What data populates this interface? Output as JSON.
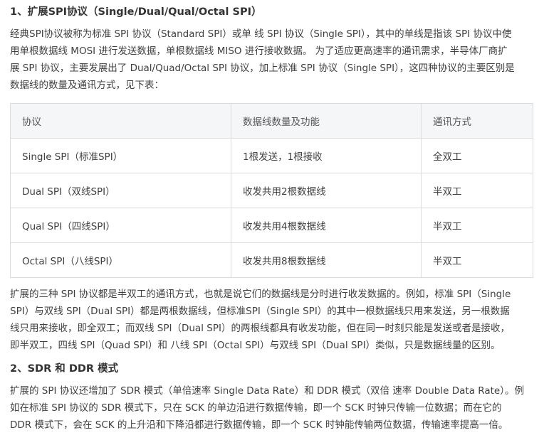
{
  "section1": {
    "heading": "1、扩展SPI协议（Single/Dual/Qual/Octal SPI）",
    "intro_lines": [
      "经典SPI协议被称为标准 SPI 协议（Standard SPI）或单 线 SPI 协议（Single SPI），其中的单线是指该 SPI 协议中使",
      "用单根数据线 MOSI 进行发送数据，单根数据线 MISO 进行接收数据。 为了适应更高速率的通讯需求，半导体厂商扩",
      "展 SPI 协议，主要发展出了 Dual/Quad/Octal SPI 协议，加上标准 SPI 协议（Single SPI），这四种协议的主要区别是",
      "数据线的数量及通讯方式，见下表："
    ]
  },
  "table": {
    "headers": [
      "协议",
      "数据线数量及功能",
      "通讯方式"
    ],
    "rows": [
      [
        "Single SPI（标准SPI）",
        "1根发送，1根接收",
        "全双工"
      ],
      [
        "Dual SPI（双线SPI）",
        "收发共用2根数据线",
        "半双工"
      ],
      [
        "Qual SPI（四线SPI）",
        "收发共用4根数据线",
        "半双工"
      ],
      [
        "Octal SPI（八线SPI）",
        "收发共用8根数据线",
        "半双工"
      ]
    ]
  },
  "section1_after": {
    "lines": [
      "扩展的三种 SPI 协议都是半双工的通讯方式，也就是说它们的数据线是分时进行收发数据的。例如，标准 SPI（Single",
      "SPI）与双线 SPI（Dual SPI）都是两根数据线，但标准SPI（Single SPI）的其中一根数据线只用来发送，另一根数据",
      "线只用来接收，即全双工；而双线 SPI（Dual SPI）的两根线都具有收发功能，但在同一时刻只能是发送或者是接收，",
      "即半双工，四线 SPI（Quad SPI）和 八线 SPI（Octal SPI）与双线 SPI（Dual SPI）类似，只是数据线量的区别。"
    ]
  },
  "section2": {
    "heading": "2、SDR 和 DDR 模式",
    "lines": [
      "扩展的 SPI 协议还增加了 SDR 模式（单倍速率 Single Data Rate）和 DDR 模式（双倍 速率 Double Data Rate）。例",
      "如在标准 SPI 协议的 SDR 模式下，只在 SCK 的单边沿进行数据传输，即一个 SCK 时钟只传输一位数据；而在它的",
      "DDR 模式下，会在 SCK 的上升沿和下降沿都进行数据传输，即一个 SCK 时钟能传输两位数据，传输速率提高一倍。"
    ]
  }
}
